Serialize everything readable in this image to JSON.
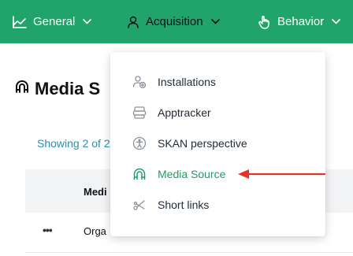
{
  "nav": {
    "items": [
      {
        "label": "General",
        "icon": "chart-icon"
      },
      {
        "label": "Acquisition",
        "icon": "user-icon"
      },
      {
        "label": "Behavior",
        "icon": "hand-pointer-icon"
      }
    ]
  },
  "page": {
    "title": "Media S",
    "showing": "Showing 2 of 2"
  },
  "table": {
    "header": "Medi",
    "rows": [
      {
        "actions": "•••",
        "name": "Orga"
      }
    ]
  },
  "dropdown": {
    "items": [
      {
        "label": "Installations",
        "icon": "user-plus-icon",
        "active": false
      },
      {
        "label": "Apptracker",
        "icon": "database-icon",
        "active": false
      },
      {
        "label": "SKAN perspective",
        "icon": "accessibility-icon",
        "active": false
      },
      {
        "label": "Media Source",
        "icon": "magnet-icon",
        "active": true
      },
      {
        "label": "Short links",
        "icon": "scissors-icon",
        "active": false
      }
    ]
  },
  "colors": {
    "nav_bg": "#20a46b",
    "active_item": "#1c9e64",
    "link": "#2a8fa6",
    "annotation_arrow": "#e53425"
  }
}
